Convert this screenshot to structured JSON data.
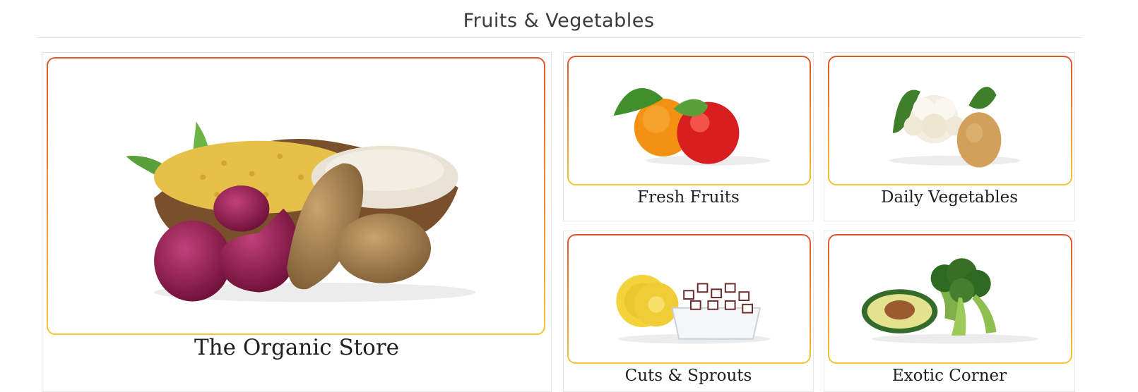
{
  "section": {
    "title": "Fruits & Vegetables"
  },
  "cards": [
    {
      "label": "The Organic Store",
      "image_icon": "organic-produce-image"
    },
    {
      "label": "Fresh Fruits",
      "image_icon": "orange-apple-image"
    },
    {
      "label": "Daily Vegetables",
      "image_icon": "cauliflower-potato-image"
    },
    {
      "label": "Cuts & Sprouts",
      "image_icon": "pineapple-coconut-cuts-image"
    },
    {
      "label": "Exotic Corner",
      "image_icon": "avocado-broccoli-image"
    }
  ],
  "colors": {
    "frame_top": "#e2542a",
    "frame_bottom": "#f2c534",
    "border": "#e6e6e6"
  }
}
